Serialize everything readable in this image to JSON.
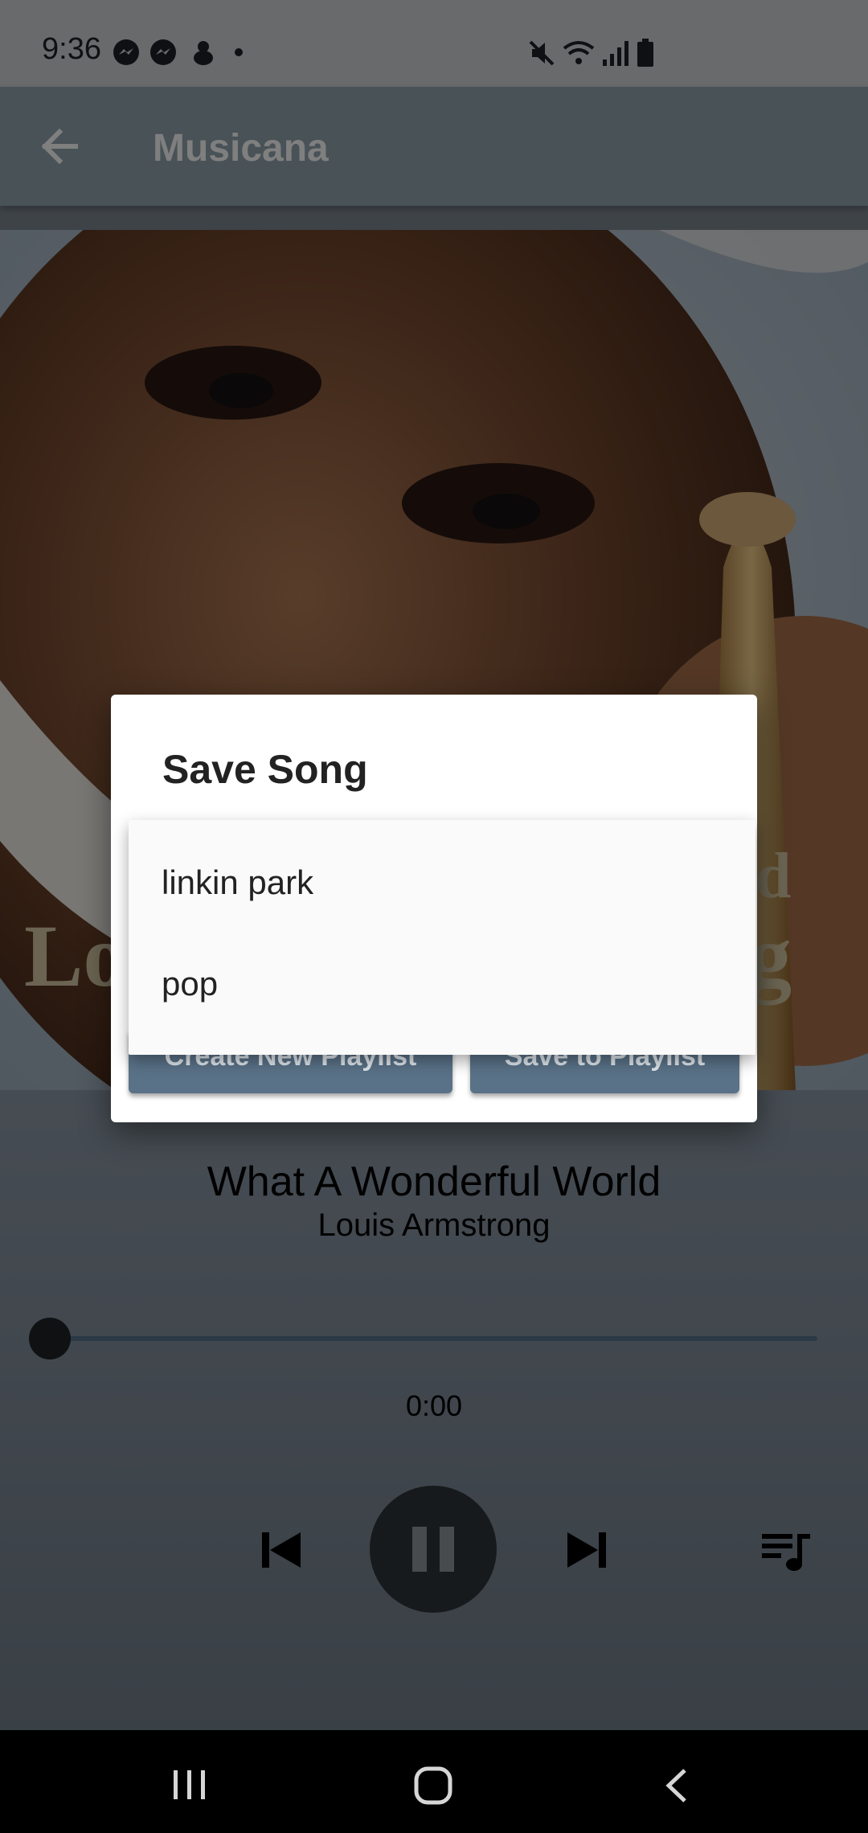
{
  "status_bar": {
    "time": "9:36",
    "left_icons": [
      "messenger-icon",
      "messenger-icon",
      "app-notification-icon",
      "dot-icon"
    ],
    "right_icons": [
      "mute-icon",
      "wifi-icon",
      "signal-icon",
      "battery-icon"
    ]
  },
  "app_bar": {
    "back_icon": "back-arrow-icon",
    "title": "Musicana"
  },
  "album_art": {
    "cover_text_fragments": [
      "Lo",
      "d",
      "g"
    ]
  },
  "player": {
    "song_title": "What A Wonderful World",
    "artist": "Louis Armstrong",
    "elapsed": "0:00",
    "progress": 0,
    "controls": [
      "skip-previous-icon",
      "pause-icon",
      "skip-next-icon",
      "queue-music-icon"
    ]
  },
  "dialog": {
    "title": "Save Song",
    "dropdown_options": [
      "linkin park",
      "pop"
    ],
    "buttons": {
      "create_label": "Create New Playlist",
      "save_label": "Save to Playlist"
    }
  },
  "nav_bar": {
    "buttons": [
      "recent-apps-icon",
      "home-icon",
      "back-icon"
    ]
  },
  "colors": {
    "app_bar": "#90a4ae",
    "dialog_button": "#5a7288",
    "scrim": "rgba(0,0,0,0.5)"
  }
}
